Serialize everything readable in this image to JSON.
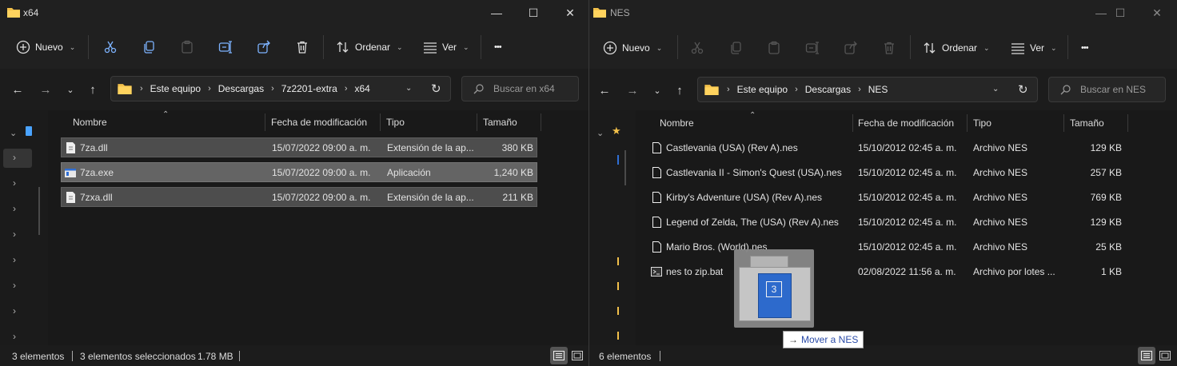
{
  "left": {
    "title": "x64",
    "controls": {
      "min": "—",
      "max": "☐",
      "close": "✕"
    },
    "cmd": {
      "new_label": "Nuevo",
      "sort_label": "Ordenar",
      "view_label": "Ver",
      "more_label": "•••"
    },
    "breadcrumb": [
      "Este equipo",
      "Descargas",
      "7z2201-extra",
      "x64"
    ],
    "search_placeholder": "Buscar en x64",
    "columns": {
      "name": "Nombre",
      "date": "Fecha de modificación",
      "type": "Tipo",
      "size": "Tamaño"
    },
    "files": [
      {
        "name": "7za.dll",
        "date": "15/07/2022 09:00 a. m.",
        "type": "Extensión de la ap...",
        "size": "380 KB",
        "icon": "dll-icon"
      },
      {
        "name": "7za.exe",
        "date": "15/07/2022 09:00 a. m.",
        "type": "Aplicación",
        "size": "1,240 KB",
        "icon": "exe-icon"
      },
      {
        "name": "7zxa.dll",
        "date": "15/07/2022 09:00 a. m.",
        "type": "Extensión de la ap...",
        "size": "211 KB",
        "icon": "dll-icon"
      }
    ],
    "status": {
      "count": "3 elementos",
      "selected": "3 elementos seleccionados",
      "size": "1.78 MB"
    }
  },
  "right": {
    "title": "NES",
    "controls": {
      "min": "—",
      "max": "☐",
      "close": "✕"
    },
    "cmd": {
      "new_label": "Nuevo",
      "sort_label": "Ordenar",
      "view_label": "Ver",
      "more_label": "•••"
    },
    "breadcrumb": [
      "Este equipo",
      "Descargas",
      "NES"
    ],
    "search_placeholder": "Buscar en NES",
    "columns": {
      "name": "Nombre",
      "date": "Fecha de modificación",
      "type": "Tipo",
      "size": "Tamaño"
    },
    "files": [
      {
        "name": "Castlevania (USA) (Rev A).nes",
        "date": "15/10/2012 02:45 a. m.",
        "type": "Archivo NES",
        "size": "129 KB",
        "icon": "file-icon"
      },
      {
        "name": "Castlevania II - Simon's Quest (USA).nes",
        "date": "15/10/2012 02:45 a. m.",
        "type": "Archivo NES",
        "size": "257 KB",
        "icon": "file-icon"
      },
      {
        "name": "Kirby's Adventure (USA) (Rev A).nes",
        "date": "15/10/2012 02:45 a. m.",
        "type": "Archivo NES",
        "size": "769 KB",
        "icon": "file-icon"
      },
      {
        "name": "Legend of Zelda, The (USA) (Rev A).nes",
        "date": "15/10/2012 02:45 a. m.",
        "type": "Archivo NES",
        "size": "129 KB",
        "icon": "file-icon"
      },
      {
        "name": "Mario Bros. (World).nes",
        "date": "15/10/2012 02:45 a. m.",
        "type": "Archivo NES",
        "size": "25 KB",
        "icon": "file-icon"
      },
      {
        "name": "nes to zip.bat",
        "date": "02/08/2022 11:56 a. m.",
        "type": "Archivo por lotes ...",
        "size": "1 KB",
        "icon": "bat-icon"
      }
    ],
    "status": {
      "count": "6 elementos"
    }
  },
  "drag": {
    "count": "3",
    "tooltip": "Mover a NES"
  },
  "colors": {
    "accent_folder": "#f2c04a",
    "selection": "#4d4d4d",
    "tooltip_text": "#2a4ba8"
  }
}
